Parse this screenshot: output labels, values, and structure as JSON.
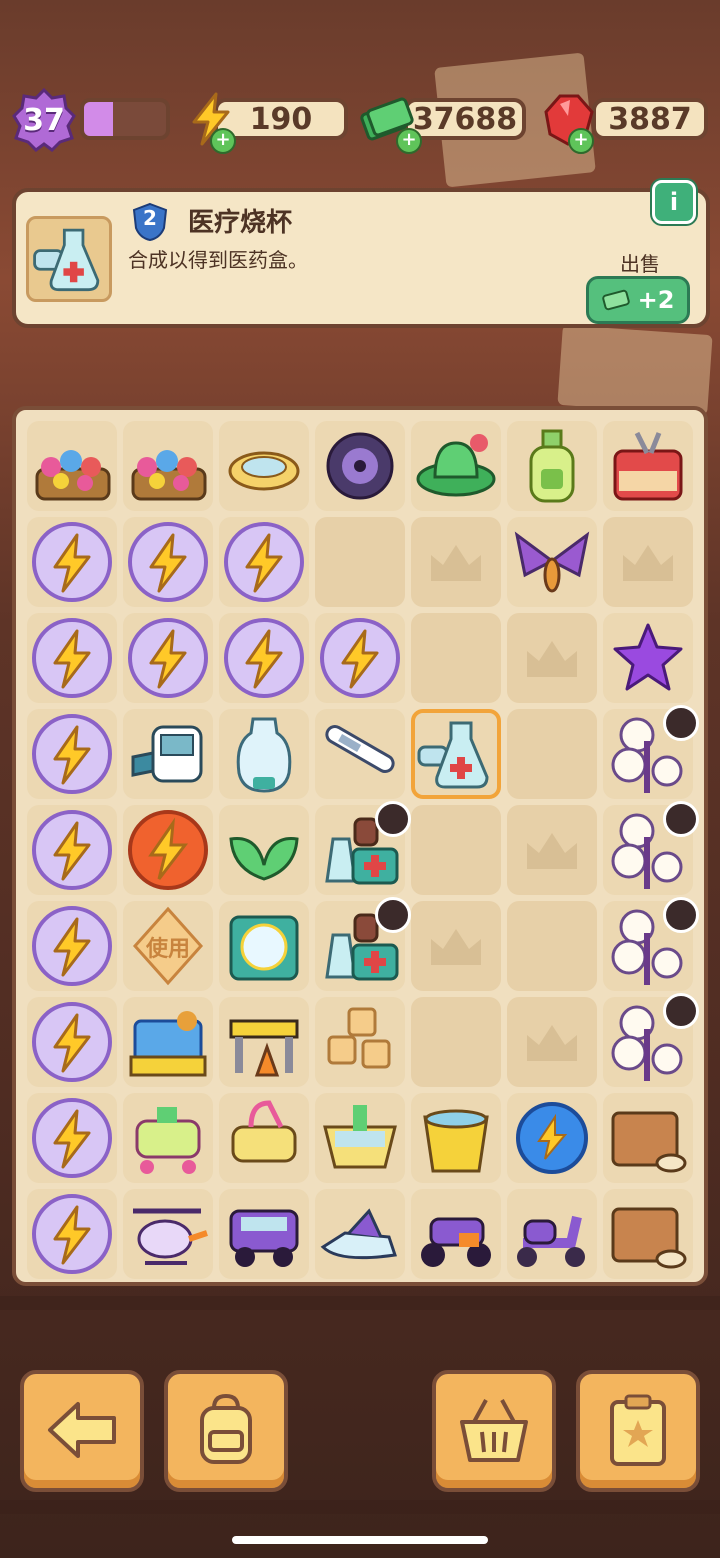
{
  "status": {
    "level": "37",
    "level_progress": 0.35,
    "energy": "190",
    "cash": "37688",
    "gems": "3887"
  },
  "info_panel": {
    "item_level": "2",
    "item_name": "医疗烧杯",
    "description": "合成以得到医药盒。",
    "info_button": "i",
    "sell_label": "出售",
    "sell_price": "+2"
  },
  "board": {
    "rows": [
      [
        "flower-basket",
        "flower-basket",
        "ring-dish",
        "wheel",
        "green-hat",
        "lotion-bottle",
        "toolbox"
      ],
      [
        "energy-orb",
        "energy-orb",
        "energy-orb",
        "empty",
        "locked",
        "moth",
        "locked"
      ],
      [
        "energy-orb",
        "energy-orb",
        "energy-orb",
        "energy-orb",
        "empty",
        "locked",
        "star"
      ],
      [
        "energy-orb",
        "blood-pressure-monitor",
        "water-bottle",
        "thermometer",
        "medical-beaker",
        "empty",
        "cotton-flower"
      ],
      [
        "energy-orb",
        "energy-orb-red",
        "leaf",
        "medicine-kit",
        "empty",
        "locked",
        "cotton-flower"
      ],
      [
        "energy-orb",
        "use-token",
        "first-aid-case",
        "medicine-kit",
        "locked",
        "empty",
        "cotton-flower"
      ],
      [
        "energy-orb",
        "gift-box",
        "barrier",
        "sugar-cubes",
        "empty",
        "locked",
        "cotton-flower"
      ],
      [
        "energy-orb",
        "stroller",
        "stroller-yellow",
        "bath-basket",
        "bucket",
        "energy-orb-blue",
        "crate"
      ],
      [
        "energy-orb",
        "helicopter",
        "jeep",
        "jetski",
        "atv",
        "scooter",
        "crate"
      ]
    ],
    "use_token_label": "使用"
  },
  "bottom_bar": [
    "back-arrow-icon",
    "backpack-icon",
    "basket-icon",
    "task-clipboard-icon"
  ],
  "colors": {
    "accent": "#f3b55e",
    "panel": "#f5e6c6",
    "border": "#6d4330",
    "energy": "#ffc928",
    "purple": "#b06ad6"
  }
}
